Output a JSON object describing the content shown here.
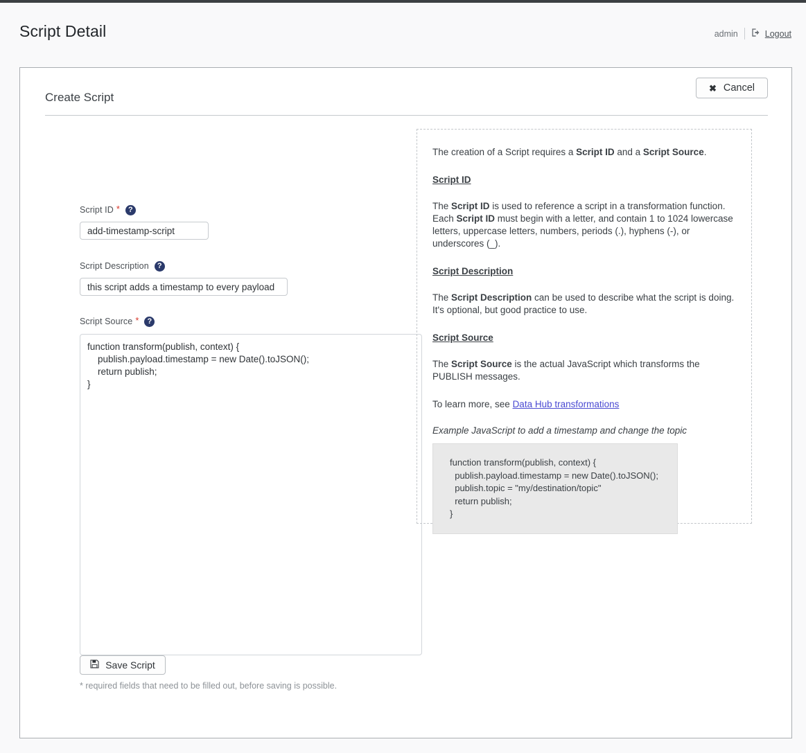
{
  "header": {
    "title": "Script Detail",
    "user": "admin",
    "logout_label": "Logout",
    "logout_icon": "sign-out-icon"
  },
  "card": {
    "title": "Create Script",
    "cancel_label": "Cancel",
    "cancel_icon": "close-x-icon"
  },
  "form": {
    "script_id": {
      "label": "Script ID",
      "required_marker": "*",
      "help_icon": "question-mark-icon",
      "value": "add-timestamp-script",
      "placeholder": ""
    },
    "script_description": {
      "label": "Script Description",
      "help_icon": "question-mark-icon",
      "value": "this script adds a timestamp to every payload",
      "placeholder": ""
    },
    "script_source": {
      "label": "Script Source",
      "required_marker": "*",
      "help_icon": "question-mark-icon",
      "value": "function transform(publish, context) {\n    publish.payload.timestamp = new Date().toJSON();\n    return publish;\n}",
      "placeholder": ""
    },
    "save_label": "Save Script",
    "save_icon": "floppy-disk-icon",
    "footnote": "* required fields that need to be filled out, before saving is possible."
  },
  "info": {
    "intro_1": "The creation of a Script requires a ",
    "intro_b1": "Script ID",
    "intro_2": " and a ",
    "intro_b2": "Script Source",
    "intro_3": ".",
    "heading_script_id": "Script ID",
    "script_id_1": "The ",
    "script_id_b1": "Script ID",
    "script_id_2": " is used to reference a script in a transformation function. Each ",
    "script_id_b2": "Script ID",
    "script_id_3": " must begin with a letter, and contain 1 to 1024 lowercase letters, uppercase letters, numbers, periods (.), hyphens (-), or underscores (_).",
    "heading_script_description": "Script Description",
    "script_desc_1": "The ",
    "script_desc_b1": "Script Description",
    "script_desc_2": " can be used to describe what the script is doing. It's optional, but good practice to use.",
    "heading_script_source": "Script Source",
    "script_src_1": "The ",
    "script_src_b1": "Script Source",
    "script_src_2": " is the actual JavaScript which transforms the PUBLISH messages.",
    "learn_more_prefix": "To learn more, see ",
    "learn_more_link": "Data Hub transformations",
    "example_caption": "Example JavaScript to add a timestamp and change the topic",
    "example_code": "function transform(publish, context) {\n  publish.payload.timestamp = new Date().toJSON();\n  publish.topic = \"my/destination/topic\"\n  return publish;\n}"
  },
  "colors": {
    "page_background": "#f9f9fa",
    "card_background": "#ffffff",
    "help_icon": "#2b3a6b",
    "required_star": "#d8372a",
    "link": "#4a4ad2",
    "example_box": "#e9e9e9"
  }
}
